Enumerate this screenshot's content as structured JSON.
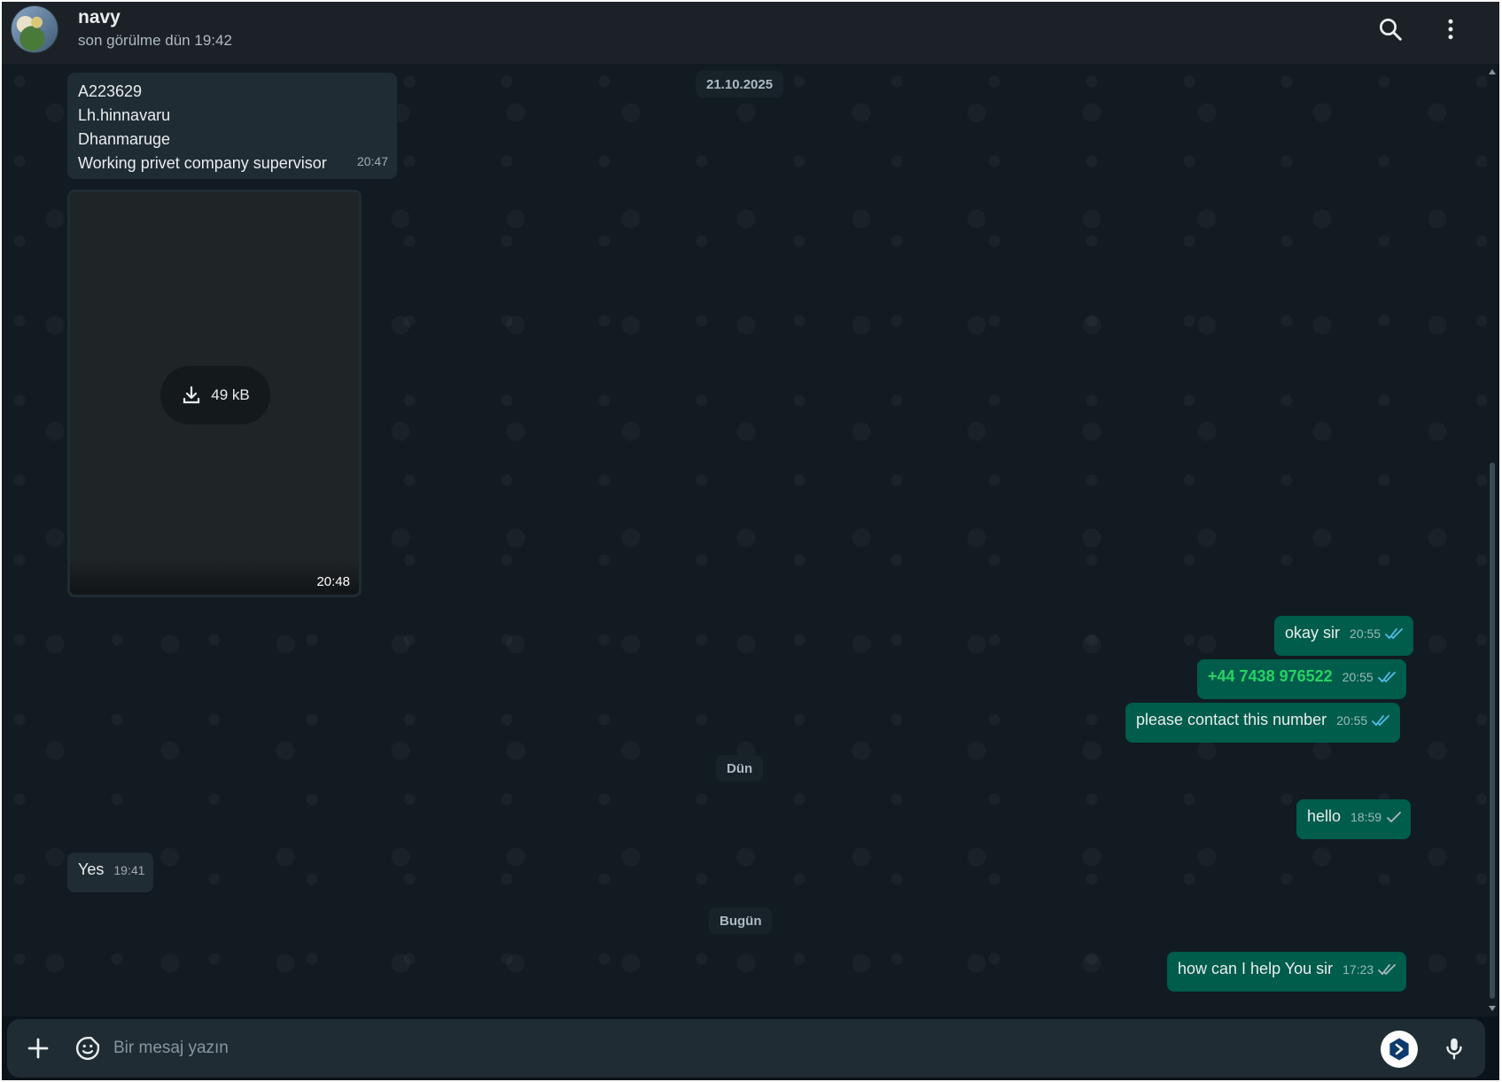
{
  "header": {
    "contact_name": "navy",
    "status": "son görülme dün 19:42",
    "search_icon": "search-icon",
    "menu_icon": "kebab-menu-icon"
  },
  "dates": {
    "d1": "21.10.2025",
    "d2": "Dün",
    "d3": "Bugün"
  },
  "messages": {
    "m1": {
      "lines": [
        "A223629",
        "Lh.hinnavaru",
        "Dhanmaruge",
        "Working privet company supervisor"
      ],
      "time": "20:47"
    },
    "media": {
      "size": "49 kB",
      "time": "20:48"
    },
    "m2": {
      "text": "okay sir",
      "time": "20:55",
      "ticks": "read"
    },
    "m3": {
      "text": "+44 7438 976522",
      "time": "20:55",
      "ticks": "read"
    },
    "m4": {
      "text": "please contact this number",
      "time": "20:55",
      "ticks": "read"
    },
    "m5": {
      "text": "hello",
      "time": "18:59",
      "ticks": "sent"
    },
    "m6": {
      "text": "Yes",
      "time": "19:41"
    },
    "m7": {
      "text": "how can I help You sir",
      "time": "17:23",
      "ticks": "read"
    }
  },
  "composer": {
    "placeholder": "Bir mesaj yazın",
    "attach_icon": "plus-icon",
    "sticker_icon": "sticker-icon",
    "mic_icon": "microphone-icon"
  },
  "colors": {
    "background": "#111b21",
    "incoming_bubble": "#202c33",
    "outgoing_bubble": "#005c4b",
    "read_ticks": "#53bdeb",
    "phone_link": "#25d366"
  }
}
